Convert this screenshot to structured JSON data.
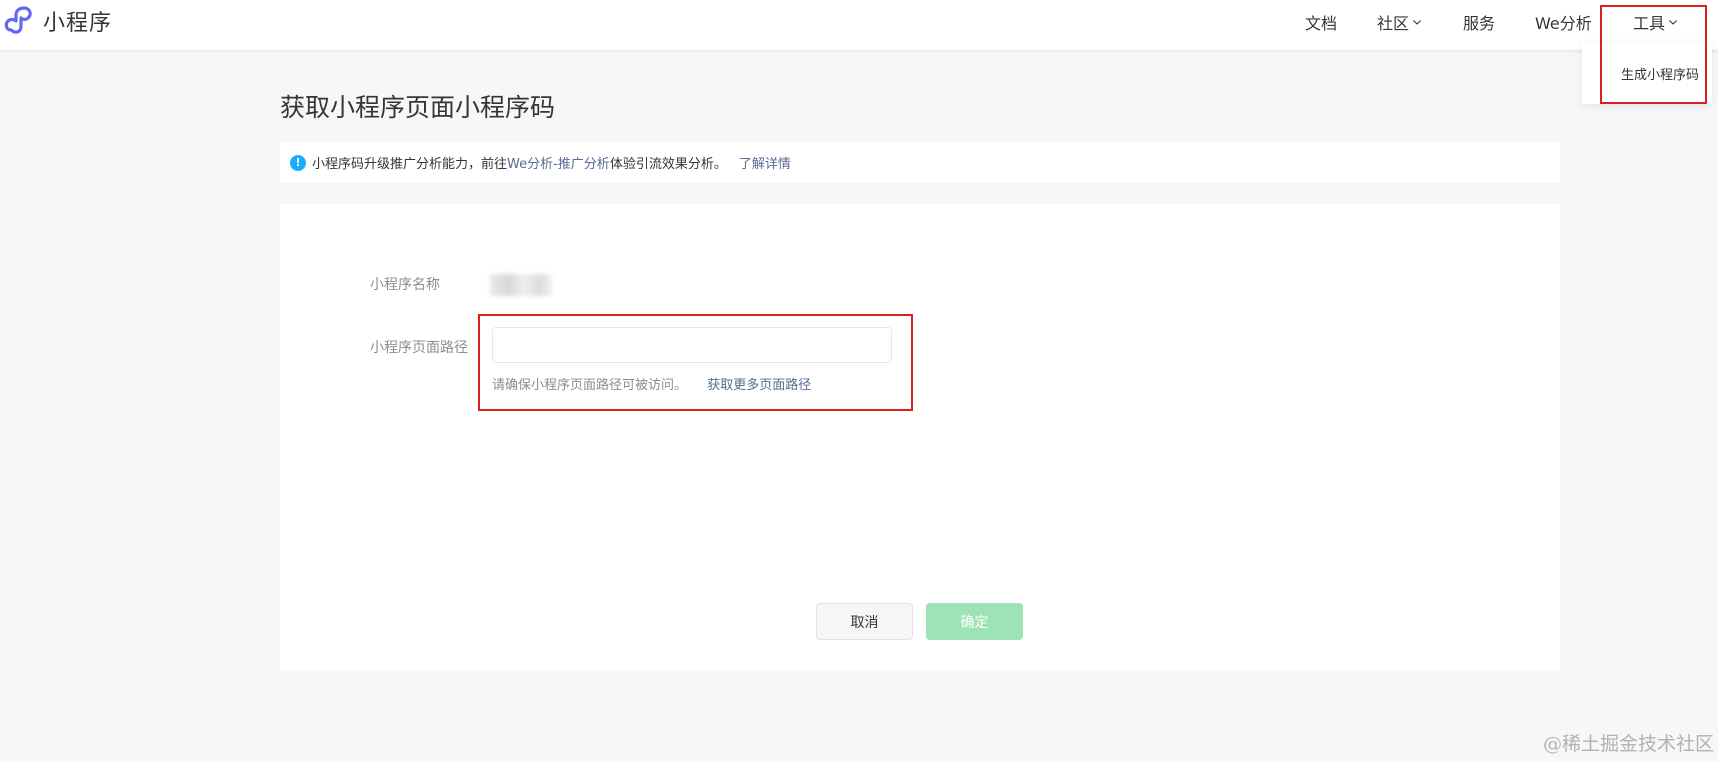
{
  "brand": {
    "name": "小程序",
    "logo_icon": "mini-program-logo-icon",
    "logo_color": "#6467f0"
  },
  "nav": {
    "docs": "文档",
    "community": "社区",
    "service": "服务",
    "we_analysis": "We分析",
    "tools": "工具"
  },
  "dropdown": {
    "generate_code": "生成小程序码"
  },
  "page": {
    "title": "获取小程序页面小程序码"
  },
  "notice": {
    "text_before": "小程序码升级推广分析能力，前往",
    "link_text": "We分析-推广分析",
    "text_after": "体验引流效果分析。",
    "more_link": "了解详情"
  },
  "form": {
    "name_label": "小程序名称",
    "path_label": "小程序页面路径",
    "path_value": "",
    "path_placeholder": "",
    "help_text": "请确保小程序页面路径可被访问。",
    "help_link": "获取更多页面路径"
  },
  "buttons": {
    "cancel": "取消",
    "confirm": "确定"
  },
  "watermark": "@稀土掘金技术社区",
  "colors": {
    "accent_link": "#576b95",
    "confirm_disabled": "#9ee3b6",
    "highlight_red": "#d9201f",
    "info_blue": "#1aadff"
  }
}
